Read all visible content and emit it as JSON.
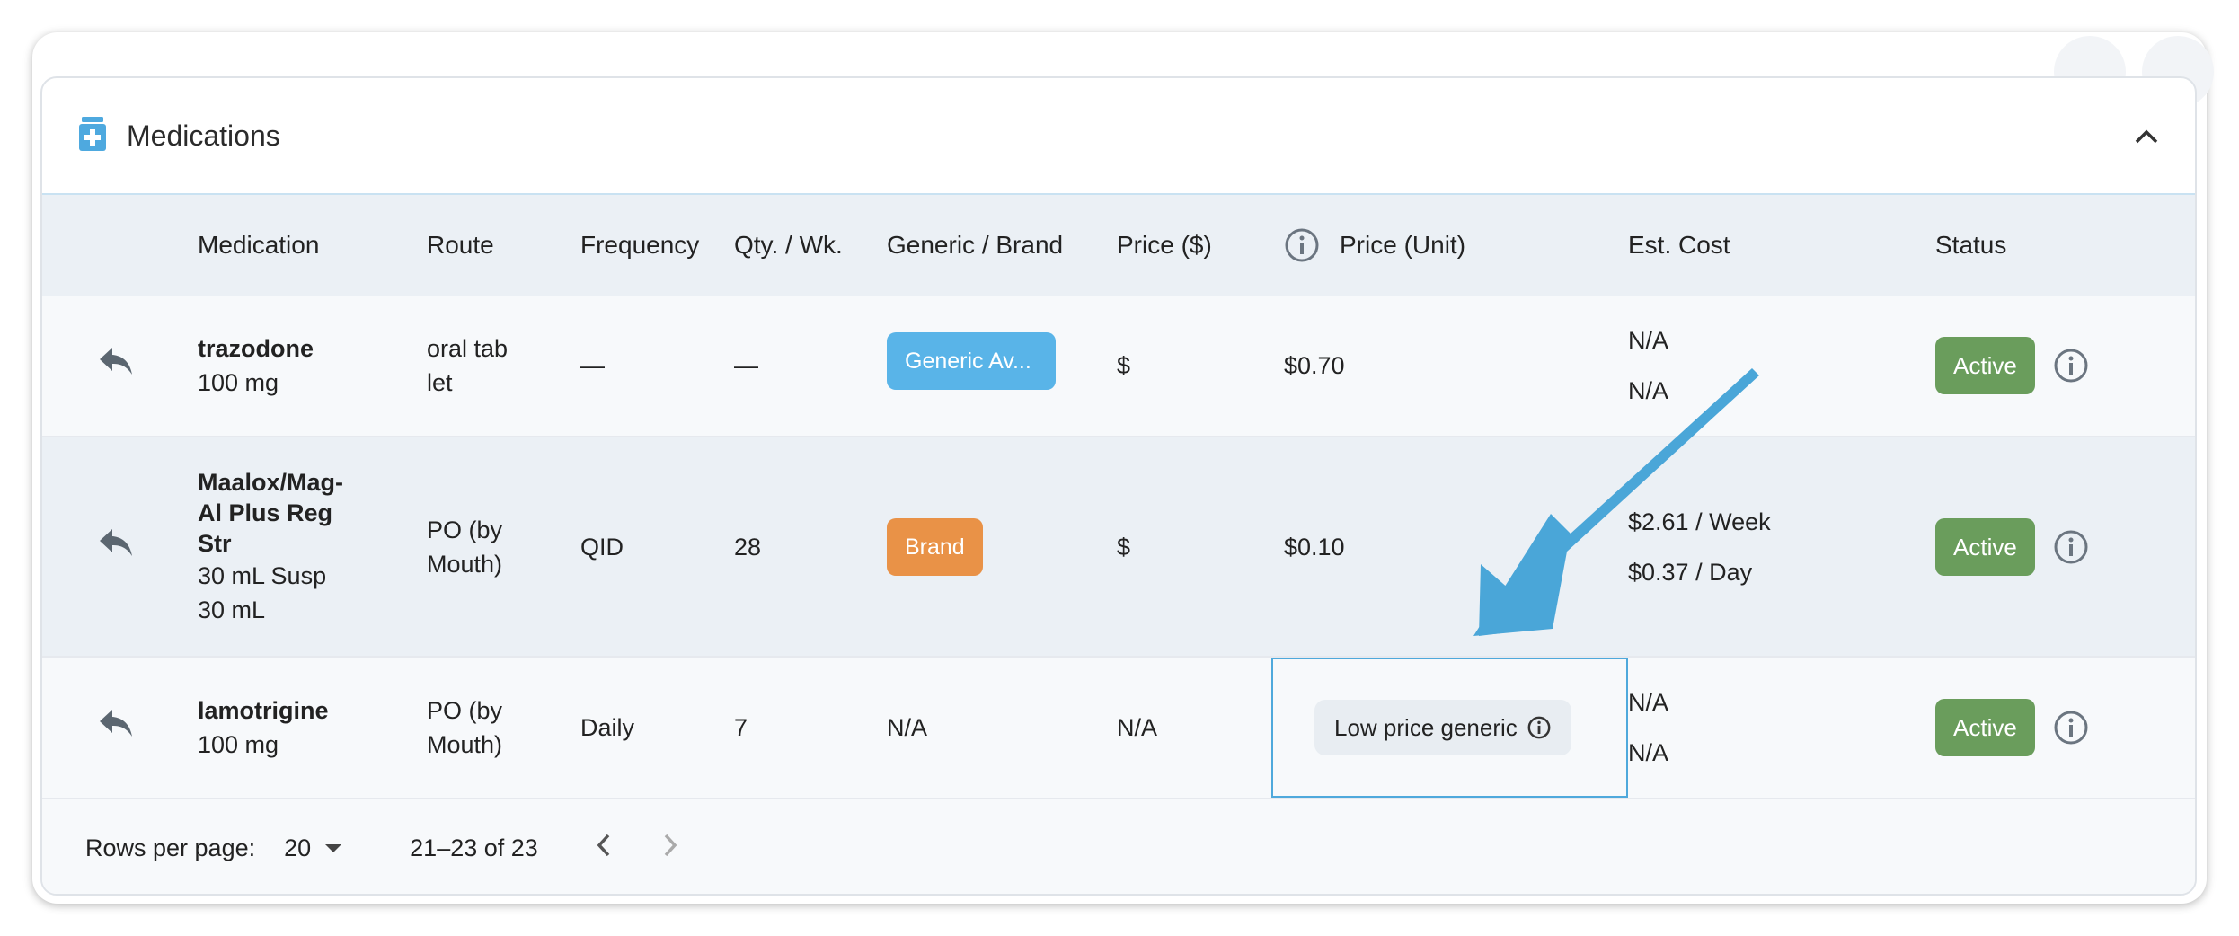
{
  "section": {
    "title": "Medications"
  },
  "columns": [
    "Medication",
    "Route",
    "Frequency",
    "Qty. / Wk.",
    "Generic / Brand",
    "Price ($)",
    "Price (Unit)",
    "Est. Cost",
    "Status"
  ],
  "rows": [
    {
      "name": "trazodone",
      "dose_lines": [
        "100 mg"
      ],
      "route": "oral tab let",
      "frequency": "—",
      "qty": "—",
      "generic_brand": "Generic Av...",
      "price_symbol": "$",
      "price_unit": "$0.70",
      "est_cost": [
        "N/A",
        "N/A"
      ],
      "status": "Active"
    },
    {
      "name": "Maalox/Mag-Al Plus Reg Str",
      "dose_lines": [
        "30 mL Susp",
        "30 mL"
      ],
      "route": "PO (by Mouth)",
      "frequency": "QID",
      "qty": "28",
      "generic_brand": "Brand",
      "price_symbol": "$",
      "price_unit": "$0.10",
      "est_cost": [
        "$2.61 / Week",
        "$0.37 / Day"
      ],
      "status": "Active"
    },
    {
      "name": "lamotrigine",
      "dose_lines": [
        "100 mg"
      ],
      "route": "PO (by Mouth)",
      "frequency": "Daily",
      "qty": "7",
      "generic_brand": "N/A",
      "price_symbol": "N/A",
      "price_unit_chip": "Low price generic",
      "est_cost": [
        "N/A",
        "N/A"
      ],
      "status": "Active"
    }
  ],
  "footer": {
    "rows_per_page_label": "Rows per page:",
    "rows_per_page_value": "20",
    "range": "21–23 of 23"
  },
  "colors": {
    "generic_badge": "#59b4e8",
    "brand_badge": "#e99247",
    "active_status": "#6a9d5c",
    "annotation_arrow": "#4aa6d8",
    "header_icon": "#4ea9df"
  },
  "icons": {
    "header": "medication-bottle-icon",
    "collapse": "chevron-up-icon",
    "row_action": "reply-arrow-icon",
    "info": "info-circle-icon",
    "rows_dropdown": "caret-down-icon",
    "prev": "chevron-left-icon",
    "next": "chevron-right-icon"
  }
}
